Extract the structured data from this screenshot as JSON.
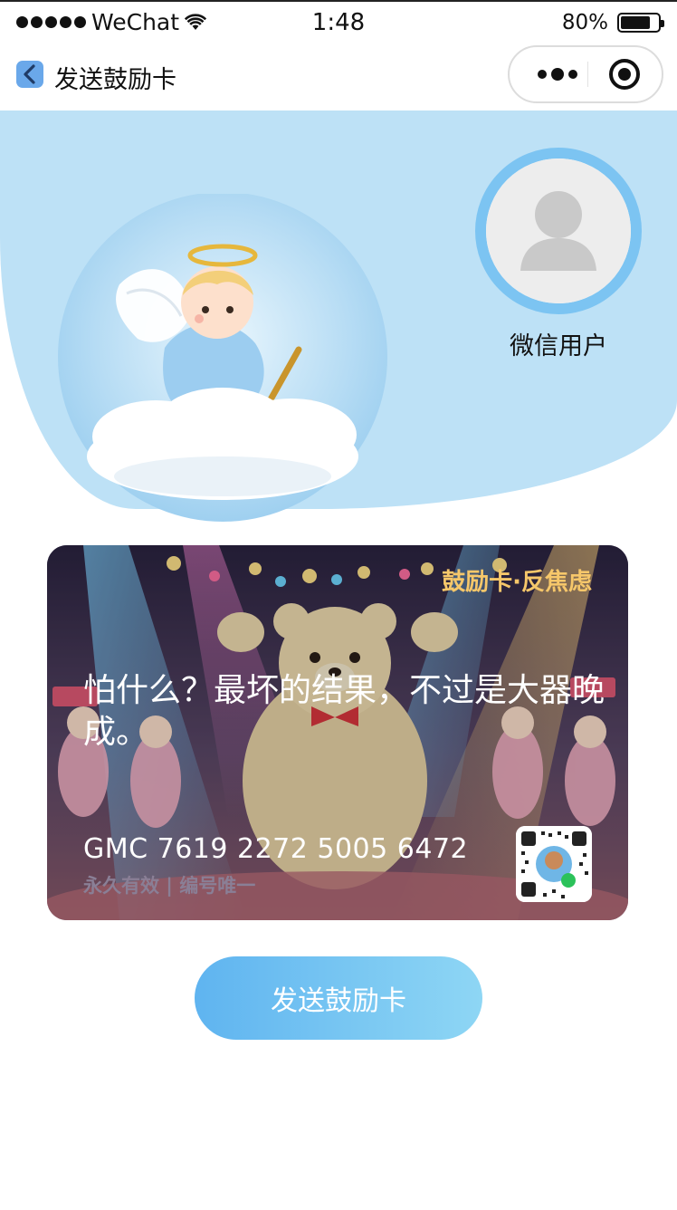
{
  "status_bar": {
    "carrier": "WeChat",
    "time": "1:48",
    "battery": "80%",
    "battery_level": 0.8
  },
  "nav": {
    "title": "发送鼓励卡",
    "back_icon": "chevron-left-icon",
    "more_icon": "more-dots-icon",
    "close_icon": "target-close-icon"
  },
  "profile": {
    "name": "微信用户",
    "avatar_icon": "default-user-icon"
  },
  "card": {
    "tag": "鼓励卡·反焦虑",
    "quote": "怕什么？最坏的结果，不过是大器晚成。",
    "number": "GMC 7619 2272 5005 6472",
    "sub": "永久有效 | 编号唯一",
    "qr_icon": "mini-program-qr-code"
  },
  "actions": {
    "send_label": "发送鼓励卡"
  },
  "colors": {
    "hero_bg": "#bde1f6",
    "avatar_ring": "#7cc4f2",
    "card_tag": "#f6c76a",
    "button_start": "#5fb4f0",
    "button_end": "#8ed6f4"
  }
}
